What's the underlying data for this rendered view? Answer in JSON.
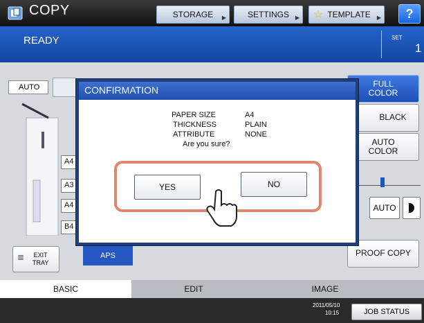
{
  "header": {
    "app_title": "COPY",
    "storage_label": "STORAGE",
    "settings_label": "SETTINGS",
    "template_label": "TEMPLATE",
    "help_label": "?"
  },
  "status": {
    "text": "READY",
    "set_label": "SET",
    "set_value": "1"
  },
  "left_panel": {
    "auto_label": "AUTO",
    "paper_sizes": [
      "A4",
      "A3",
      "A4",
      "B4"
    ],
    "exit_tray_label": "EXIT\nTRAY",
    "aps_label": "APS"
  },
  "right_panel": {
    "full_color_label": "FULL\nCOLOR",
    "black_label": "BLACK",
    "auto_color_label": "AUTO\nCOLOR",
    "auto_density_label": "AUTO",
    "proof_copy_label": "PROOF COPY"
  },
  "tabs": [
    "BASIC",
    "EDIT",
    "IMAGE"
  ],
  "footer": {
    "date": "2011/05/10",
    "time": "10:15",
    "job_status_label": "JOB STATUS"
  },
  "dialog": {
    "title": "CONFIRMATION",
    "paper_size_label": "PAPER SIZE",
    "paper_size_value": "A4",
    "thickness_label": "THICKNESS",
    "thickness_value": "PLAIN",
    "attribute_label": "ATTRIBUTE",
    "attribute_value": "NONE",
    "question": "Are you sure?",
    "yes_label": "YES",
    "no_label": "NO"
  },
  "colors": {
    "status_bar": "#1346a3",
    "dialog_header": "#2a5bbd",
    "highlight": "#e0856e"
  }
}
